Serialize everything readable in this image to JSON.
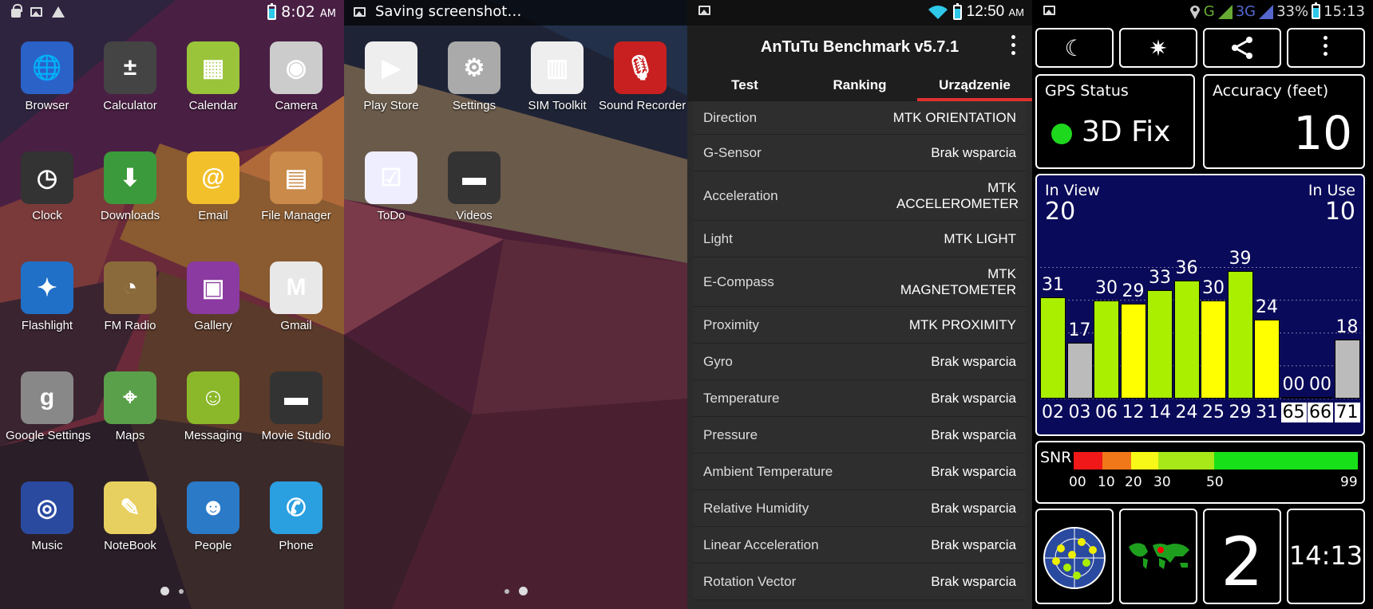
{
  "panel1": {
    "status": {
      "time": "8:02",
      "ampm": "AM"
    },
    "apps": [
      {
        "label": "Browser",
        "icon": "globe-icon",
        "color": "#2a62c8"
      },
      {
        "label": "Calculator",
        "icon": "calculator-icon",
        "color": "#444"
      },
      {
        "label": "Calendar",
        "icon": "calendar-icon",
        "color": "#9ac43a"
      },
      {
        "label": "Camera",
        "icon": "camera-icon",
        "color": "#ccc"
      },
      {
        "label": "Clock",
        "icon": "clock-icon",
        "color": "#333"
      },
      {
        "label": "Downloads",
        "icon": "download-icon",
        "color": "#3b9a3b"
      },
      {
        "label": "Email",
        "icon": "email-icon",
        "color": "#f2c02b"
      },
      {
        "label": "File Manager",
        "icon": "folder-icon",
        "color": "#c98a4a"
      },
      {
        "label": "Flashlight",
        "icon": "flashlight-icon",
        "color": "#2070c8"
      },
      {
        "label": "FM Radio",
        "icon": "radio-icon",
        "color": "#8a6a3a"
      },
      {
        "label": "Gallery",
        "icon": "gallery-icon",
        "color": "#8a3aa0"
      },
      {
        "label": "Gmail",
        "icon": "gmail-icon",
        "color": "#e8e8e8"
      },
      {
        "label": "Google Settings",
        "icon": "google-settings-icon",
        "color": "#888"
      },
      {
        "label": "Maps",
        "icon": "maps-icon",
        "color": "#5aa04a"
      },
      {
        "label": "Messaging",
        "icon": "messaging-icon",
        "color": "#8ab82a"
      },
      {
        "label": "Movie Studio",
        "icon": "clapper-icon",
        "color": "#333"
      },
      {
        "label": "Music",
        "icon": "music-icon",
        "color": "#2a4aa0"
      },
      {
        "label": "NoteBook",
        "icon": "notebook-icon",
        "color": "#e8d060"
      },
      {
        "label": "People",
        "icon": "people-icon",
        "color": "#2a7ac8"
      },
      {
        "label": "Phone",
        "icon": "phone-icon",
        "color": "#2aa0e0"
      }
    ]
  },
  "panel2": {
    "notification": "Saving screenshot…",
    "apps": [
      {
        "label": "Play Store",
        "icon": "play-store-icon",
        "color": "#eee"
      },
      {
        "label": "Settings",
        "icon": "settings-gear-icon",
        "color": "#aaa"
      },
      {
        "label": "SIM Toolkit",
        "icon": "sim-card-icon",
        "color": "#eee"
      },
      {
        "label": "Sound Recorder",
        "icon": "microphone-icon",
        "color": "#c82020"
      },
      {
        "label": "ToDo",
        "icon": "todo-icon",
        "color": "#eef"
      },
      {
        "label": "Videos",
        "icon": "clapper-icon",
        "color": "#333"
      }
    ]
  },
  "antutu": {
    "status": {
      "time": "12:50",
      "ampm": "AM"
    },
    "title": "AnTuTu Benchmark v5.7.1",
    "tabs": [
      "Test",
      "Ranking",
      "Urządzenie"
    ],
    "rows": [
      {
        "name": "Direction",
        "value": "MTK ORIENTATION"
      },
      {
        "name": "G-Sensor",
        "value": "Brak wsparcia"
      },
      {
        "name": "Acceleration",
        "value": "MTK ACCELEROMETER"
      },
      {
        "name": "Light",
        "value": "MTK LIGHT"
      },
      {
        "name": "E-Compass",
        "value": "MTK MAGNETOMETER"
      },
      {
        "name": "Proximity",
        "value": "MTK PROXIMITY"
      },
      {
        "name": "Gyro",
        "value": "Brak wsparcia"
      },
      {
        "name": "Temperature",
        "value": "Brak wsparcia"
      },
      {
        "name": "Pressure",
        "value": "Brak wsparcia"
      },
      {
        "name": "Ambient Temperature",
        "value": "Brak wsparcia"
      },
      {
        "name": "Relative Humidity",
        "value": "Brak wsparcia"
      },
      {
        "name": "Linear Acceleration",
        "value": "Brak wsparcia"
      },
      {
        "name": "Rotation Vector",
        "value": "Brak wsparcia"
      }
    ]
  },
  "gps": {
    "status": {
      "network": "G",
      "net2": "3G",
      "battery": "33%",
      "time": "15:13"
    },
    "gps_status_label": "GPS Status",
    "fix": "3D Fix",
    "accuracy_label": "Accuracy (feet)",
    "accuracy": "10",
    "in_view_label": "In View",
    "in_view": "20",
    "in_use_label": "In Use",
    "in_use": "10",
    "snr_label": "SNR",
    "snr_ticks": [
      "00",
      "10",
      "20",
      "30",
      "50",
      "99"
    ],
    "bottom_count": "2",
    "bottom_time": "14:13"
  },
  "chart_data": {
    "type": "bar",
    "categories": [
      "02",
      "03",
      "06",
      "12",
      "14",
      "24",
      "25",
      "29",
      "31",
      "65",
      "66",
      "71"
    ],
    "values": [
      31,
      17,
      30,
      29,
      33,
      36,
      30,
      39,
      24,
      0,
      0,
      18
    ],
    "value_labels": [
      "31",
      "17",
      "30",
      "29",
      "33",
      "36",
      "30",
      "39",
      "24",
      "00",
      "00",
      "18"
    ],
    "in_use": [
      true,
      false,
      true,
      true,
      true,
      true,
      true,
      true,
      true,
      false,
      false,
      false
    ],
    "colors": [
      "#aaee00",
      "#bbbbbb",
      "#aaee00",
      "#ffff00",
      "#aaee00",
      "#aaee00",
      "#ffff00",
      "#aaee00",
      "#ffff00",
      "#bbbbbb",
      "#bbbbbb",
      "#bbbbbb"
    ],
    "ylim": [
      0,
      45
    ]
  }
}
